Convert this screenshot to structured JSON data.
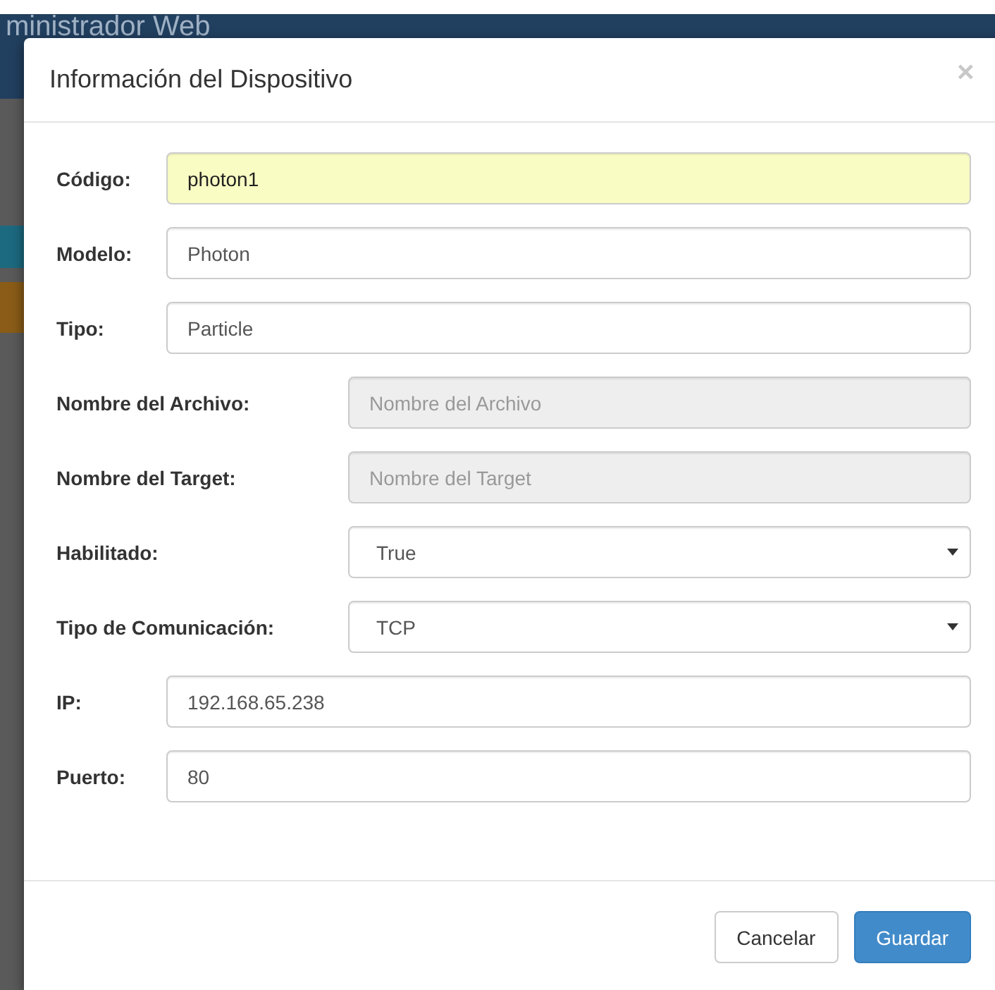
{
  "background": {
    "header_title": "ministrador Web"
  },
  "modal": {
    "title": "Información del Dispositivo",
    "close": "×",
    "groups": [
      {
        "kind": "short_labels",
        "fields": [
          {
            "label": "Código:",
            "kind": "text",
            "value": "photon1",
            "autofilled": true,
            "disabled": false
          },
          {
            "label": "Modelo:",
            "kind": "text",
            "value": "Photon",
            "autofilled": false,
            "disabled": false
          },
          {
            "label": "Tipo:",
            "kind": "text",
            "value": "Particle",
            "autofilled": false,
            "disabled": false
          }
        ]
      },
      {
        "kind": "long_labels",
        "fields": [
          {
            "label": "Nombre del Archivo:",
            "kind": "text",
            "placeholder": "Nombre del Archivo",
            "autofilled": false,
            "disabled": true
          },
          {
            "label": "Nombre del Target:",
            "kind": "text",
            "placeholder": "Nombre del Target",
            "autofilled": false,
            "disabled": true
          },
          {
            "label": "Habilitado:",
            "kind": "select",
            "value": "True",
            "autofilled": false,
            "disabled": false
          },
          {
            "label": "Tipo de Comunicación:",
            "kind": "select",
            "value": "TCP",
            "autofilled": false,
            "disabled": false
          }
        ]
      },
      {
        "kind": "short_labels",
        "fields": [
          {
            "label": "IP:",
            "kind": "text",
            "value": "192.168.65.238",
            "autofilled": false,
            "disabled": false
          },
          {
            "label": "Puerto:",
            "kind": "text",
            "value": "80",
            "autofilled": false,
            "disabled": false
          }
        ]
      }
    ],
    "buttons": [
      {
        "label": "Cancelar",
        "kind": "default"
      },
      {
        "label": "Guardar",
        "kind": "primary"
      }
    ]
  }
}
